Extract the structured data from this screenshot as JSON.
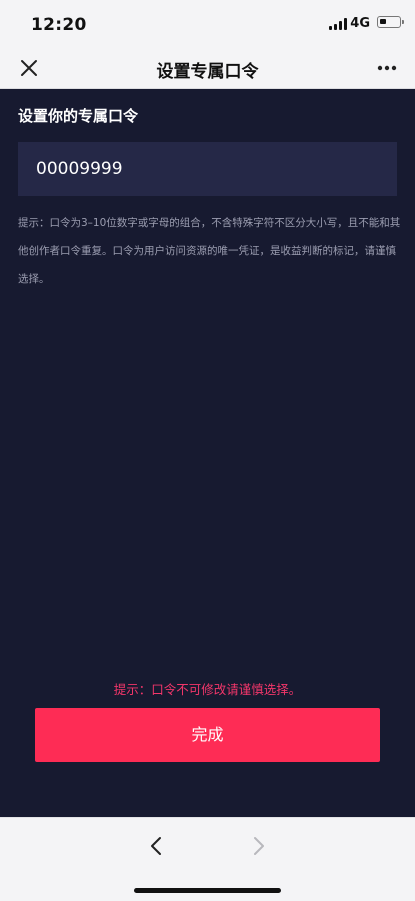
{
  "status_bar": {
    "time": "12:20",
    "network": "4G"
  },
  "nav": {
    "title": "设置专属口令",
    "close_icon": "close-icon",
    "more_icon": "more-dots-icon"
  },
  "form": {
    "section_title": "设置你的专属口令",
    "code_value": "00009999",
    "hint": "提示：口令为3–10位数字或字母的组合，不含特殊字符不区分大小写，且不能和其他创作者口令重复。口令为用户访问资源的唯一凭证，是收益判断的标记，请谨慎选择。"
  },
  "footer": {
    "warning": "提示：口令不可修改请谨慎选择。",
    "done_label": "完成"
  },
  "browser_nav": {
    "back_icon": "chevron-left-icon",
    "forward_icon": "chevron-right-icon"
  },
  "colors": {
    "background": "#171a30",
    "input_background": "#252847",
    "accent": "#fe2c55",
    "warning_text": "#f2366a"
  }
}
